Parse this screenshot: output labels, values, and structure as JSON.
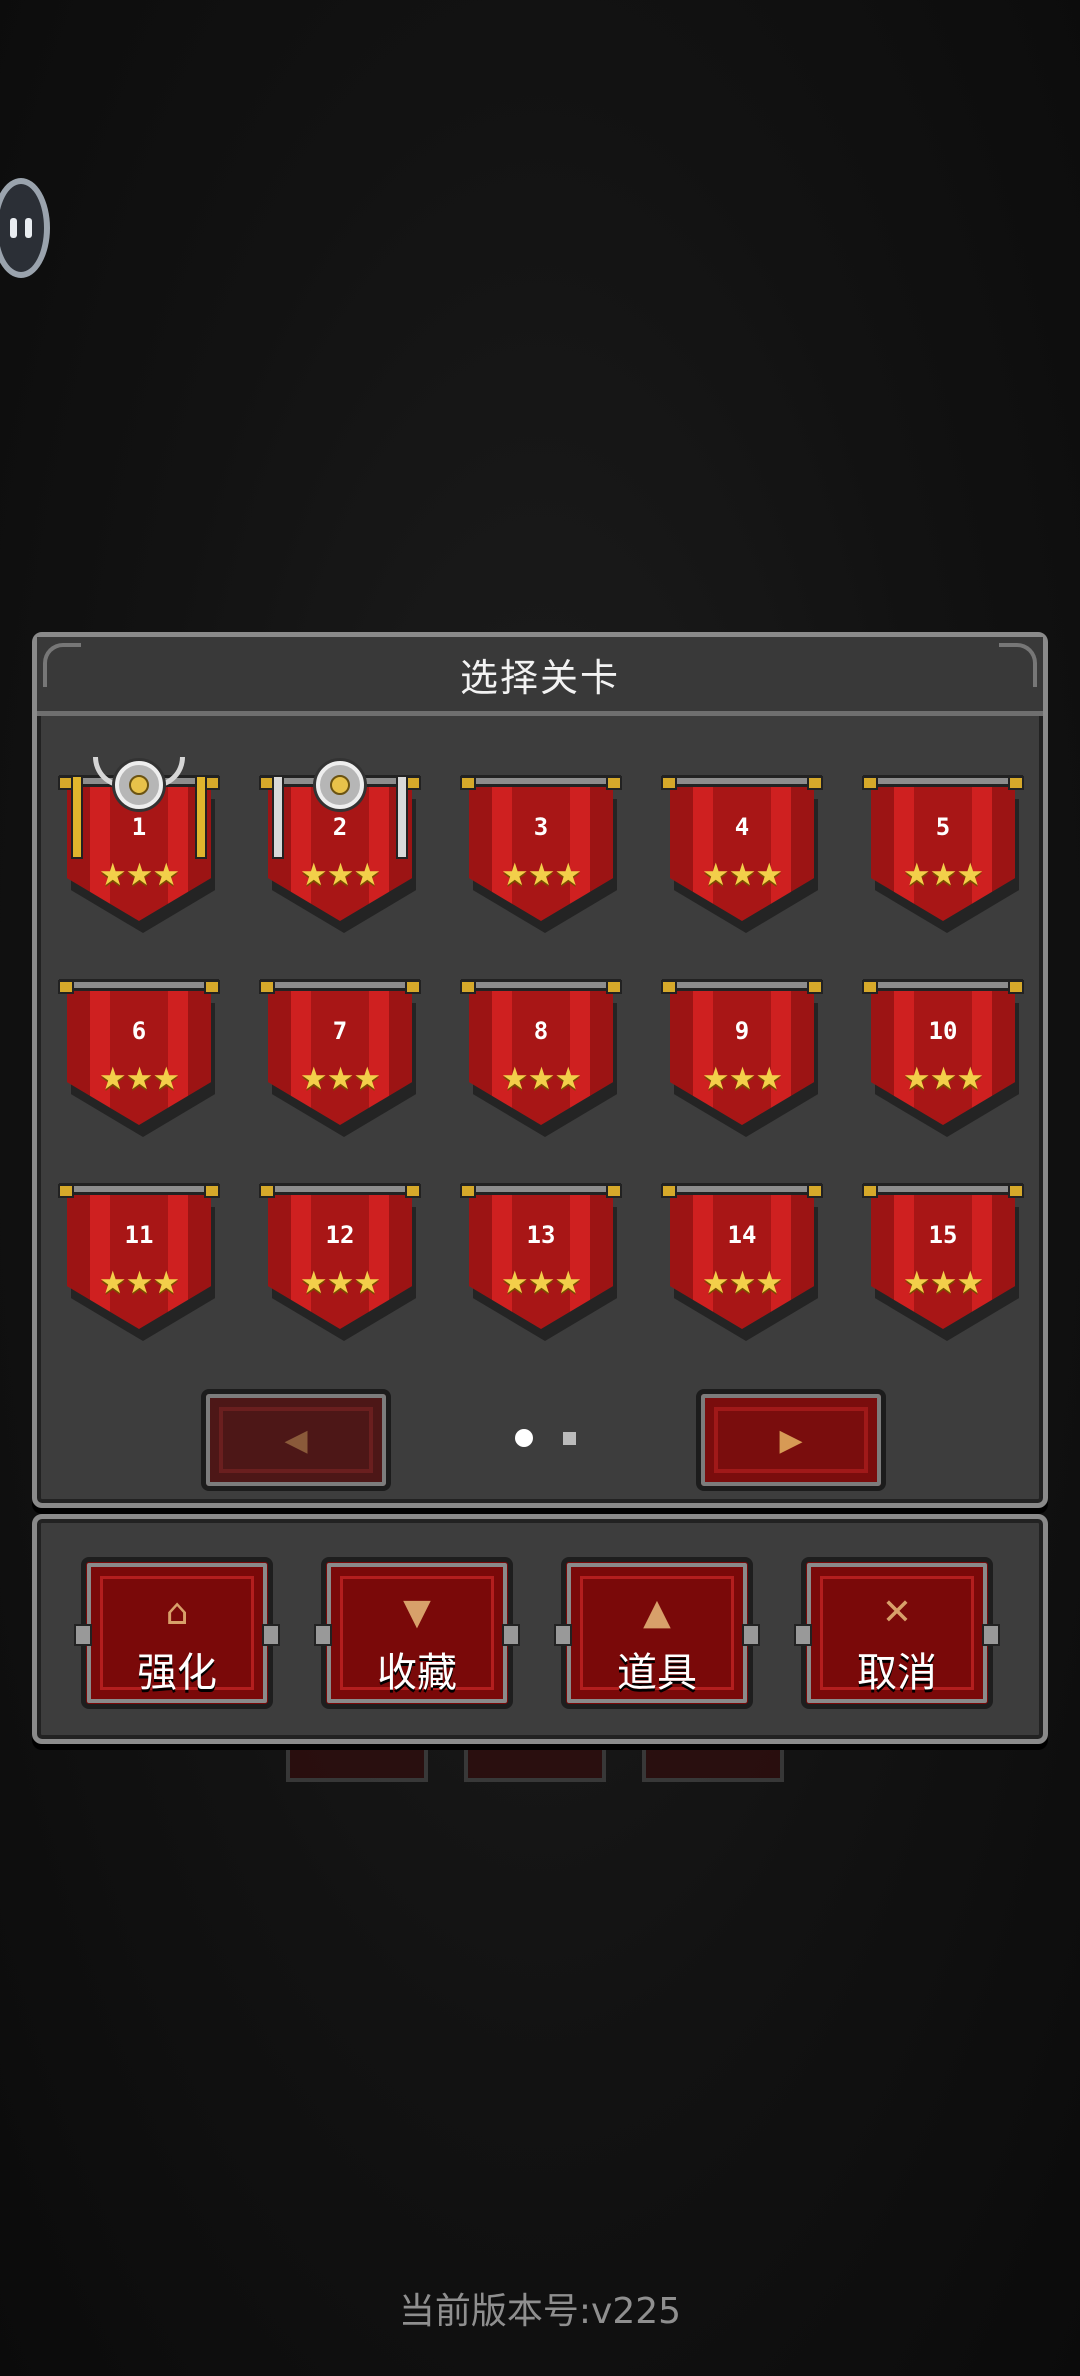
{
  "level_select": {
    "title": "选择关卡",
    "page_dots": 2,
    "current_page": 1,
    "levels": [
      {
        "num": "1",
        "stars": 3,
        "badge": "gold-horn-medal"
      },
      {
        "num": "2",
        "stars": 3,
        "badge": "silver-medal"
      },
      {
        "num": "3",
        "stars": 3
      },
      {
        "num": "4",
        "stars": 3
      },
      {
        "num": "5",
        "stars": 3
      },
      {
        "num": "6",
        "stars": 3
      },
      {
        "num": "7",
        "stars": 3
      },
      {
        "num": "8",
        "stars": 3
      },
      {
        "num": "9",
        "stars": 3
      },
      {
        "num": "10",
        "stars": 3
      },
      {
        "num": "11",
        "stars": 3
      },
      {
        "num": "12",
        "stars": 3
      },
      {
        "num": "13",
        "stars": 3
      },
      {
        "num": "14",
        "stars": 3
      },
      {
        "num": "15",
        "stars": 3
      }
    ],
    "prev_icon": "◀",
    "next_icon": "▶"
  },
  "actions": [
    {
      "label": "强化",
      "icon": "⌂",
      "icon_name": "upgrade-icon"
    },
    {
      "label": "收藏",
      "icon": "▼",
      "icon_name": "goblet-icon"
    },
    {
      "label": "道具",
      "icon": "▲",
      "icon_name": "potion-icon"
    },
    {
      "label": "取消",
      "icon": "✕",
      "icon_name": "close-icon"
    }
  ],
  "version_text": "当前版本号:v225",
  "colors": {
    "banner_red": "#cf2020",
    "star_gold": "#f3cf4a",
    "panel_gray": "#3d3d3d",
    "button_red": "#7a0909"
  }
}
